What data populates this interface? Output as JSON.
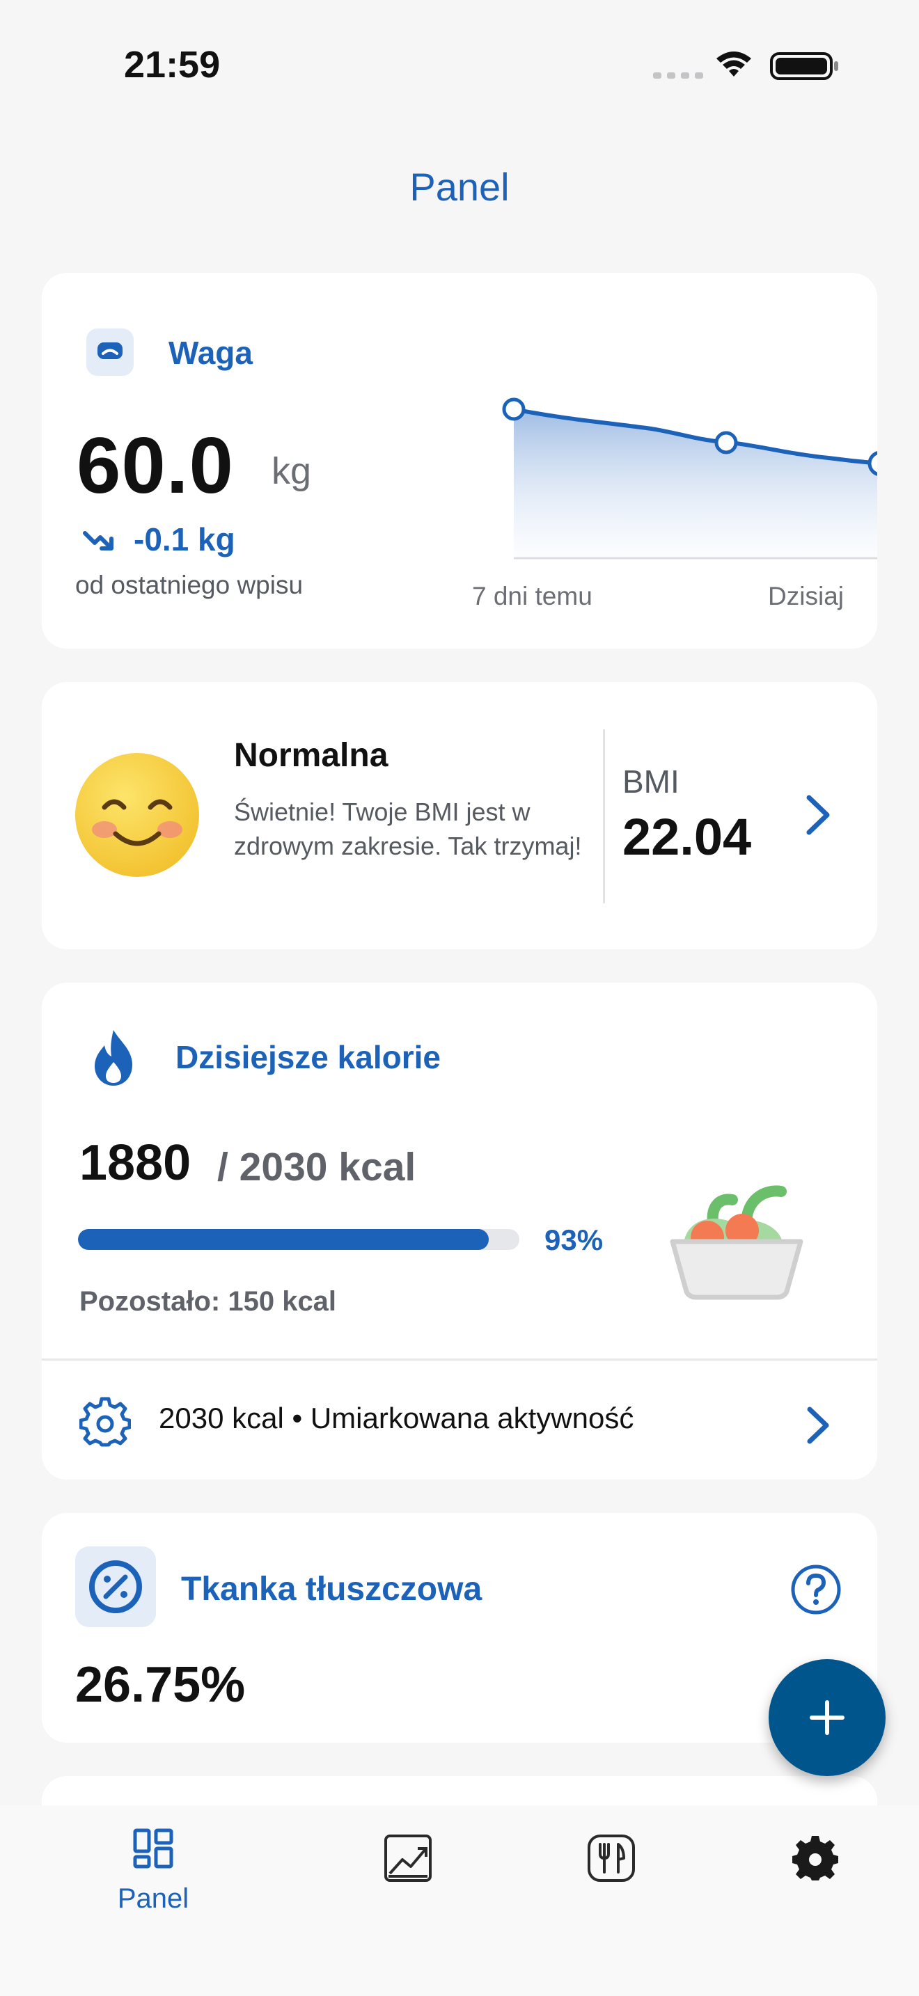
{
  "status_bar": {
    "time": "21:59"
  },
  "header": {
    "title": "Panel"
  },
  "weight_card": {
    "label": "Waga",
    "value": "60.0",
    "unit": "kg",
    "delta": "-0.1 kg",
    "delta_caption": "od ostatniego wpisu",
    "chart_start_label": "7 dni temu",
    "chart_end_label": "Dzisiaj"
  },
  "bmi_card": {
    "category": "Normalna",
    "message": "Świetnie! Twoje BMI jest w zdrowym zakresie. Tak trzymaj!",
    "label": "BMI",
    "value": "22.04"
  },
  "calories_card": {
    "title": "Dzisiejsze kalorie",
    "consumed": "1880",
    "goal_text": "/ 2030 kcal",
    "percent_label": "93%",
    "progress_fraction": 0.93,
    "remaining": "Pozostało: 150 kcal",
    "settings_text": "2030 kcal • Umiarkowana aktywność"
  },
  "body_fat_card": {
    "title": "Tkanka tłuszczowa",
    "value": "26.75%"
  },
  "tab_bar": {
    "items": [
      {
        "label": "Panel",
        "icon": "dashboard-icon",
        "active": true
      },
      {
        "label": "",
        "icon": "chart-icon",
        "active": false
      },
      {
        "label": "",
        "icon": "fork-knife-icon",
        "active": false
      },
      {
        "label": "",
        "icon": "gear-icon",
        "active": false
      }
    ]
  },
  "colors": {
    "accent": "#1b62b8",
    "fab": "#00558c",
    "background": "#f6f6f7"
  }
}
